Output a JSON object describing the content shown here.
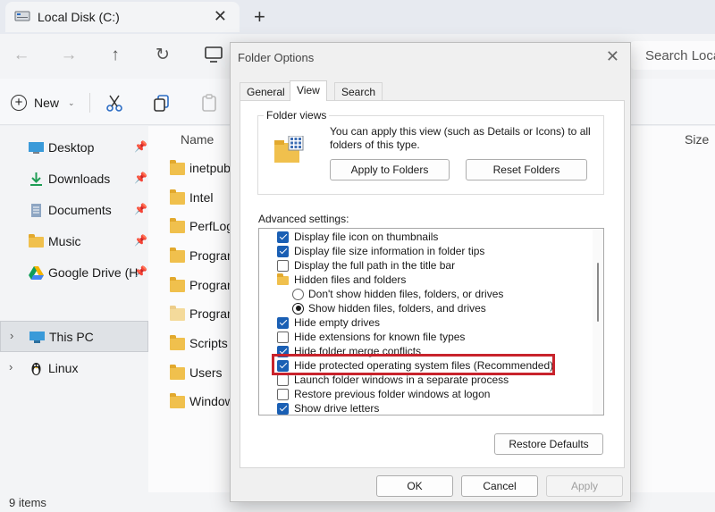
{
  "explorer": {
    "tab_title": "Local Disk (C:)",
    "search_placeholder": "Search Loca",
    "new_label": "New",
    "sidebar": [
      {
        "label": "Desktop",
        "icon": "desktop-icon",
        "pinned": true
      },
      {
        "label": "Downloads",
        "icon": "download-icon",
        "pinned": true
      },
      {
        "label": "Documents",
        "icon": "document-icon",
        "pinned": true
      },
      {
        "label": "Music",
        "icon": "folder-icon",
        "pinned": true
      },
      {
        "label": "Google Drive (H",
        "icon": "google-drive-icon",
        "pinned": true
      },
      {
        "label": "This PC",
        "icon": "pc-icon",
        "selected": true
      },
      {
        "label": "Linux",
        "icon": "linux-icon"
      }
    ],
    "columns": {
      "name": "Name",
      "size": "Size"
    },
    "files": [
      "inetpub",
      "Intel",
      "PerfLog",
      "Progran",
      "Progran",
      "Progran",
      "Scripts",
      "Users",
      "Window"
    ],
    "status": "9 items"
  },
  "dialog": {
    "title": "Folder Options",
    "tabs": [
      "General",
      "View",
      "Search"
    ],
    "active_tab": "View",
    "folder_views": {
      "legend": "Folder views",
      "description": "You can apply this view (such as Details or Icons) to all folders of this type.",
      "apply_button": "Apply to Folders",
      "reset_button": "Reset Folders"
    },
    "advanced_label": "Advanced settings:",
    "settings": [
      {
        "kind": "checkbox",
        "label": "Display file icon on thumbnails",
        "checked": true
      },
      {
        "kind": "checkbox",
        "label": "Display file size information in folder tips",
        "checked": true
      },
      {
        "kind": "checkbox",
        "label": "Display the full path in the title bar",
        "checked": false
      },
      {
        "kind": "folder",
        "label": "Hidden files and folders"
      },
      {
        "kind": "radio",
        "label": "Don't show hidden files, folders, or drives",
        "checked": false
      },
      {
        "kind": "radio",
        "label": "Show hidden files, folders, and drives",
        "checked": true
      },
      {
        "kind": "checkbox",
        "label": "Hide empty drives",
        "checked": true
      },
      {
        "kind": "checkbox",
        "label": "Hide extensions for known file types",
        "checked": false
      },
      {
        "kind": "checkbox",
        "label": "Hide folder merge conflicts",
        "checked": true
      },
      {
        "kind": "checkbox",
        "label": "Hide protected operating system files (Recommended)",
        "checked": true
      },
      {
        "kind": "checkbox",
        "label": "Launch folder windows in a separate process",
        "checked": false
      },
      {
        "kind": "checkbox",
        "label": "Restore previous folder windows at logon",
        "checked": false
      },
      {
        "kind": "checkbox",
        "label": "Show drive letters",
        "checked": true
      }
    ],
    "restore_defaults": "Restore Defaults",
    "ok": "OK",
    "cancel": "Cancel",
    "apply": "Apply",
    "highlight_color": "#c8232c"
  }
}
